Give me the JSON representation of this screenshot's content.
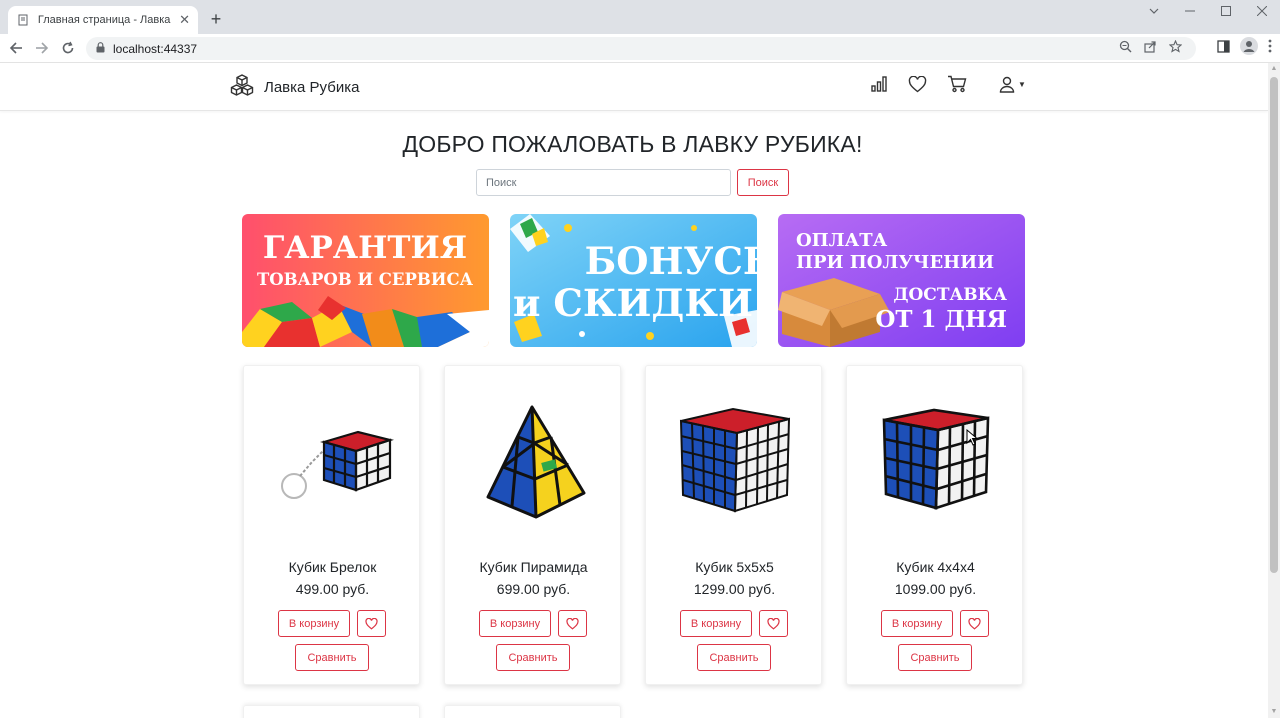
{
  "browser": {
    "tab_title": "Главная страница - Лавка Рубика",
    "tab_close": "✕",
    "new_tab": "+",
    "url": "localhost:44337"
  },
  "header": {
    "brand": "Лавка Рубика",
    "icons": [
      "chart-icon",
      "heart-icon",
      "cart-icon",
      "user-icon"
    ]
  },
  "main": {
    "welcome": "ДОБРО ПОЖАЛОВАТЬ В ЛАВКУ РУБИКА!",
    "search_placeholder": "Поиск",
    "search_button": "Поиск"
  },
  "banners": [
    {
      "line1": "ГАРАНТИЯ",
      "line2": "ТОВАРОВ И СЕРВИСА",
      "color_start": "#ff4f6d",
      "color_end": "#ff9a2e"
    },
    {
      "line1": "БОНУСЫ",
      "line2": "и СКИДКИ",
      "color_start": "#7fd3f7",
      "color_end": "#29a3ee"
    },
    {
      "line1": "ОПЛАТА",
      "line2": "ПРИ ПОЛУЧЕНИИ",
      "line3": "ДОСТАВКА",
      "line4": "ОТ 1 ДНЯ",
      "color_start": "#b76cf3",
      "color_end": "#7f3ef2"
    }
  ],
  "products": [
    {
      "name": "Кубик Брелок",
      "price": "499.00 руб.",
      "cart_label": "В корзину",
      "compare_label": "Сравнить",
      "image": "keychain-cube"
    },
    {
      "name": "Кубик Пирамида",
      "price": "699.00 руб.",
      "cart_label": "В корзину",
      "compare_label": "Сравнить",
      "image": "pyramid-cube"
    },
    {
      "name": "Кубик 5x5x5",
      "price": "1299.00 руб.",
      "cart_label": "В корзину",
      "compare_label": "Сравнить",
      "image": "cube-5x5"
    },
    {
      "name": "Кубик 4x4x4",
      "price": "1099.00 руб.",
      "cart_label": "В корзину",
      "compare_label": "Сравнить",
      "image": "cube-4x4"
    }
  ],
  "colors": {
    "accent": "#dc3545",
    "text": "#212529"
  }
}
